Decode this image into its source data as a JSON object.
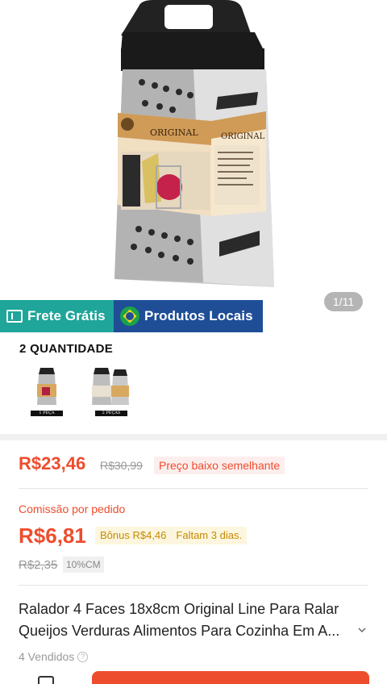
{
  "image": {
    "counter": "1/11",
    "package_labels": [
      "ORIGINAL",
      "ORIGINAL"
    ]
  },
  "badges": {
    "free_shipping": "Frete Grátis",
    "local_products": "Produtos Locais"
  },
  "variation": {
    "title": "2 QUANTIDADE",
    "options": [
      {
        "caption": "1 PEÇA"
      },
      {
        "caption": "2 PEÇAS"
      }
    ]
  },
  "price": {
    "current": "R$23,46",
    "original": "R$30,99",
    "tag": "Preço baixo semelhante"
  },
  "commission": {
    "label": "Comissão por pedido",
    "value": "R$6,81",
    "bonus": "Bônus R$4,46",
    "remaining": "Faltam 3 dias.",
    "old_value": "R$2,35",
    "rate": "10%CM"
  },
  "product": {
    "title_line1": "Ralador 4 Faces 18x8cm Original Line Para Ralar",
    "title_line2": "Queijos Verduras Alimentos Para Cozinha Em A...",
    "sold": "4 Vendidos"
  },
  "colors": {
    "accent": "#ee4d2d",
    "free_shipping_bg": "#1fa59a",
    "local_bg": "#1f4e97"
  }
}
